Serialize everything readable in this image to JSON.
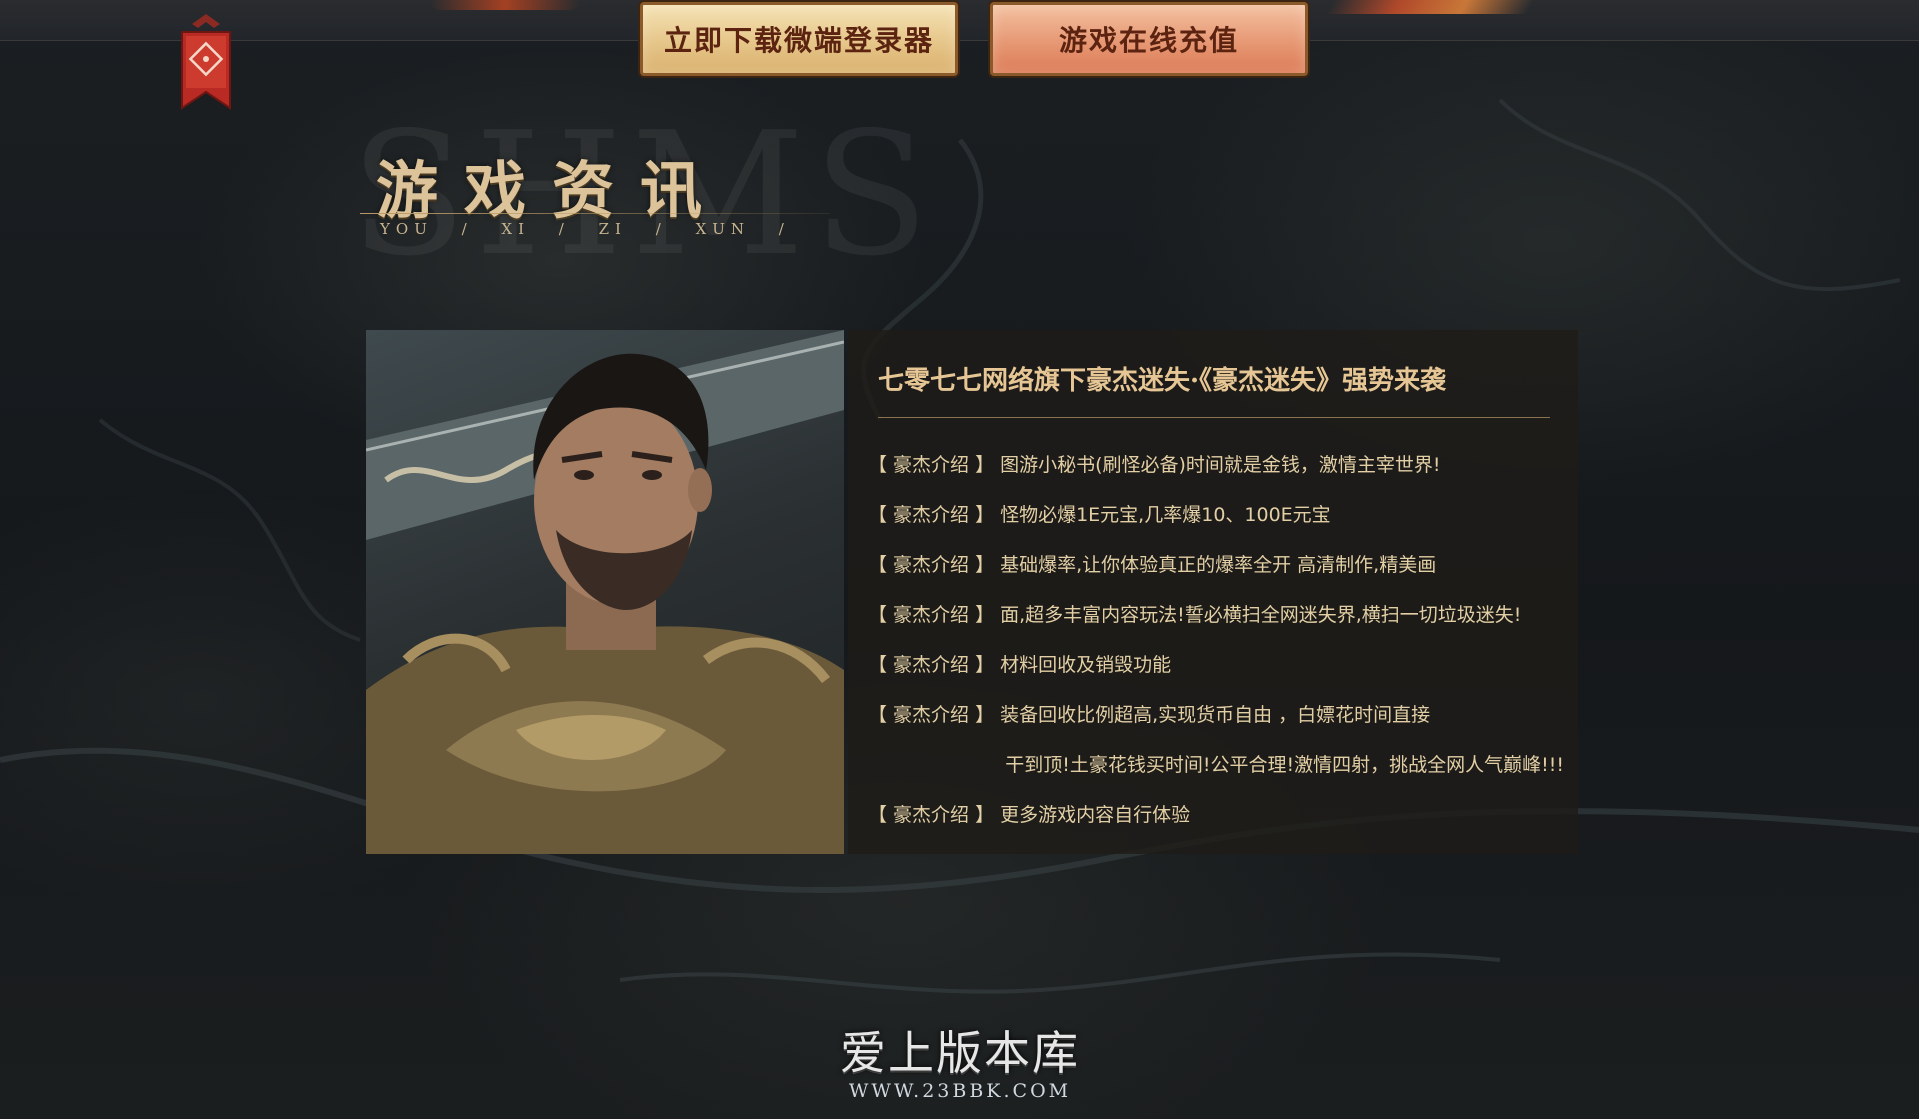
{
  "topbar": {
    "download_label": "立即下载微端登录器",
    "recharge_label": "游戏在线充值"
  },
  "section": {
    "title": "游戏资讯",
    "pinyin": "YOU / XI / ZI / XUN /",
    "watermark": "SHMS"
  },
  "article": {
    "headline": "七零七七网络旗下豪杰迷失·《豪杰迷失》强势来袭",
    "tag": "【 豪杰介绍 】",
    "items": [
      "图游小秘书(刷怪必备)时间就是金钱，激情主宰世界!",
      "怪物必爆1E元宝,几率爆10、100E元宝",
      "基础爆率,让你体验真正的爆率全开 高清制作,精美画",
      "面,超多丰富内容玩法!誓必横扫全网迷失界,横扫一切垃圾迷失!",
      "材料回收及销毁功能",
      "装备回收比例超高,实现货币自由 ，白嫖花时间直接",
      "更多游戏内容自行体验"
    ],
    "continuation": "干到顶!土豪花钱买时间!公平合理!激情四射，挑战全网人气巅峰!!!"
  },
  "footer": {
    "logo_name": "爱上版本库",
    "logo_url": "WWW.23BBK.COM"
  }
}
